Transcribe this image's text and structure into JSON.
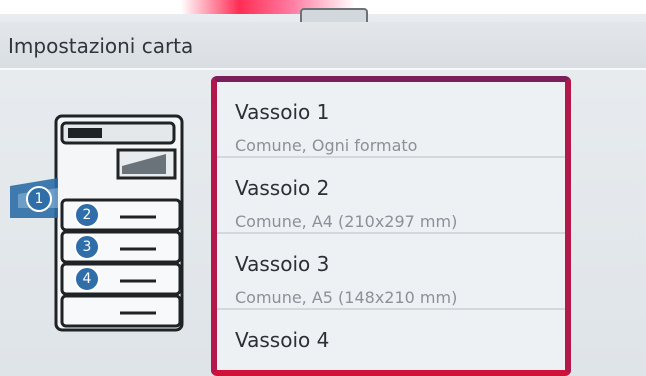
{
  "header": {
    "title": "Impostazioni carta"
  },
  "trays": [
    {
      "name": "Vassoio 1",
      "desc": "Comune, Ogni formato",
      "badge": "1"
    },
    {
      "name": "Vassoio 2",
      "desc": "Comune, A4 (210x297 mm)",
      "badge": "2"
    },
    {
      "name": "Vassoio 3",
      "desc": "Comune, A5 (148x210 mm)",
      "badge": "3"
    },
    {
      "name": "Vassoio 4",
      "desc": "",
      "badge": "4"
    }
  ],
  "colors": {
    "highlight_border": "#b3184a",
    "badge_blue": "#2f6ea8"
  }
}
